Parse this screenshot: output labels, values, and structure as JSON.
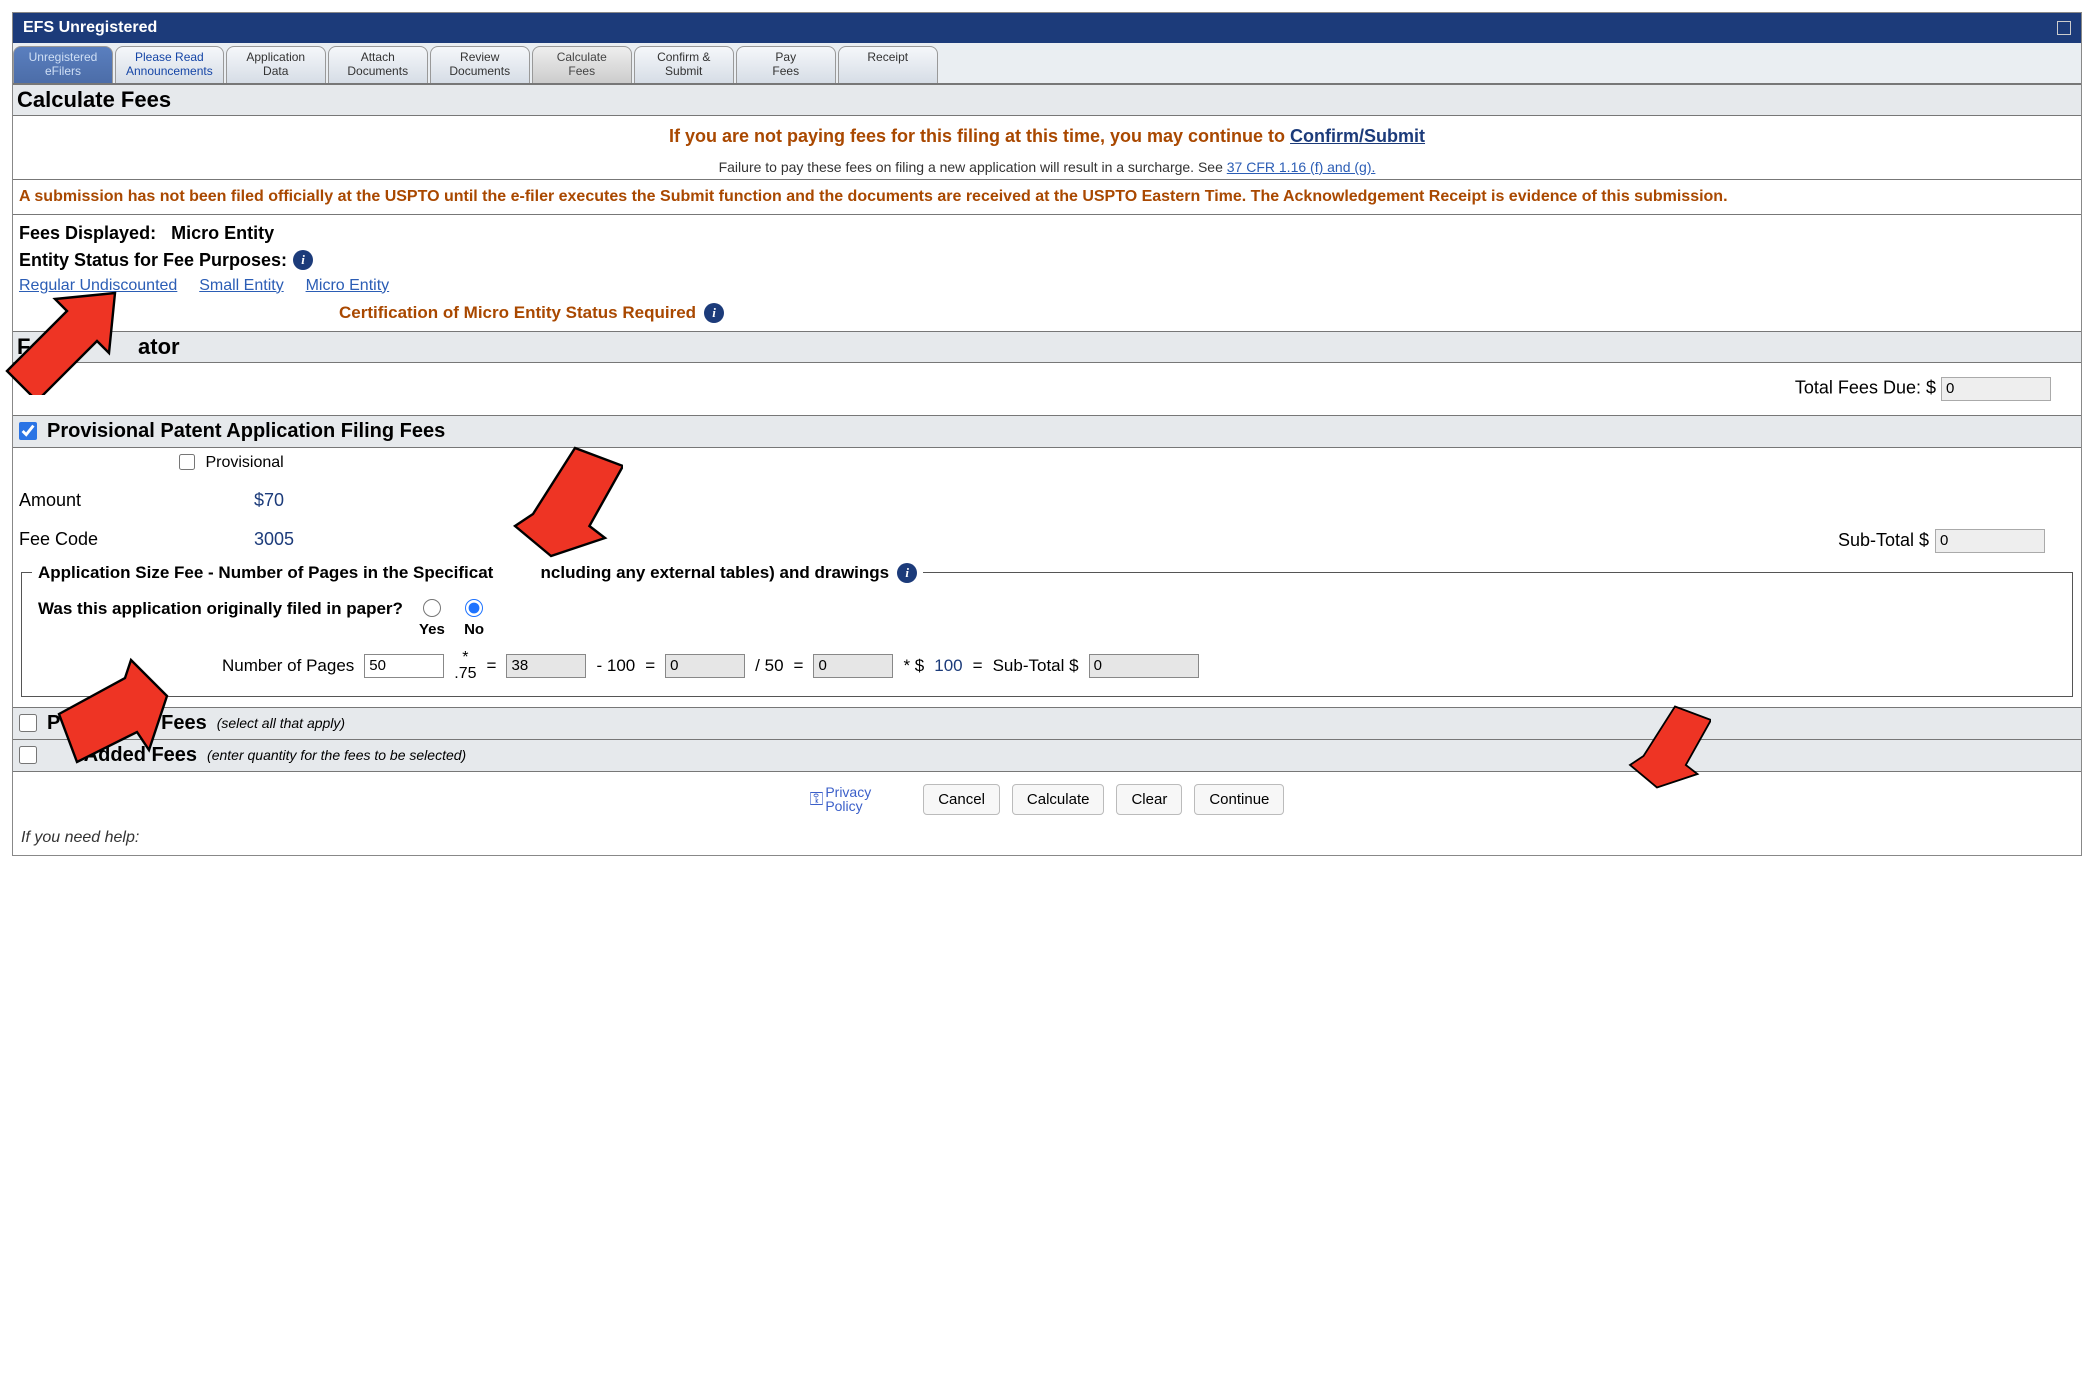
{
  "titlebar": "EFS Unregistered",
  "tabs": [
    {
      "line1": "Unregistered",
      "line2": "eFilers"
    },
    {
      "line1": "Please Read",
      "line2": "Announcements"
    },
    {
      "line1": "Application",
      "line2": "Data"
    },
    {
      "line1": "Attach",
      "line2": "Documents"
    },
    {
      "line1": "Review",
      "line2": "Documents"
    },
    {
      "line1": "Calculate",
      "line2": "Fees"
    },
    {
      "line1": "Confirm &",
      "line2": "Submit"
    },
    {
      "line1": "Pay",
      "line2": "Fees"
    },
    {
      "line1": "Receipt",
      "line2": ""
    }
  ],
  "page_title": "Calculate Fees",
  "notice": {
    "main_pre": "If you are not paying fees for this filing at this time, you may continue to ",
    "main_link": "Confirm/Submit",
    "sub_pre": "Failure to pay these fees on filing a new application will result in a surcharge. See ",
    "sub_link": "37 CFR 1.16 (f) and (g)."
  },
  "warning": "A submission has not been filed officially at the USPTO until the e-filer executes the Submit function and the documents are received at the USPTO Eastern Time. The Acknowledgement Receipt is evidence of this submission.",
  "fees_displayed_label": "Fees Displayed:",
  "fees_displayed_value": "Micro Entity",
  "entity_status_label": "Entity Status for Fee Purposes:",
  "entity_links": {
    "regular": "Regular Undiscounted",
    "small": "Small Entity",
    "micro": "Micro Entity"
  },
  "cert_required": "Certification of Micro Entity Status Required",
  "fee_calc_header": "Fee C          ator",
  "total_label": "Total Fees Due: $",
  "total_value": "0",
  "prov_header": "Provisional Patent Application Filing Fees",
  "prov_cb_label": "Provisional",
  "amount_label": "Amount",
  "amount_value": "$70",
  "code_label": "Fee Code",
  "code_value": "3005",
  "subtotal1_label": "Sub-Total $",
  "subtotal1_value": "0",
  "fieldset_legend": "Application Size Fee - Number of Pages in the Specificat          ncluding any external tables) and drawings",
  "paper_question": "Was this application originally filed in paper?",
  "yes_label": "Yes",
  "no_label": "No",
  "pages_label": "Number of Pages",
  "pages_value": "50",
  "mult_top": "*",
  "mult_bot": ".75",
  "eq": "=",
  "calc1": "38",
  "minus100": "- 100",
  "calc2": "0",
  "div50": "/ 50",
  "calc3": "0",
  "times_dollar": "* $",
  "rate": "100",
  "subtotal2_label": "Sub-Total $",
  "subtotal2_value": "0",
  "petition_header": "P               g Fees",
  "petition_sel": "(select all that apply)",
  "added_header": "Added Fees",
  "added_sel": "(enter quantity for the fees to be selected)",
  "privacy_label": "Privacy\nPolicy",
  "btn_cancel": "Cancel",
  "btn_calc": "Calculate",
  "btn_clear": "Clear",
  "btn_continue": "Continue",
  "help_note": "If you need help:"
}
